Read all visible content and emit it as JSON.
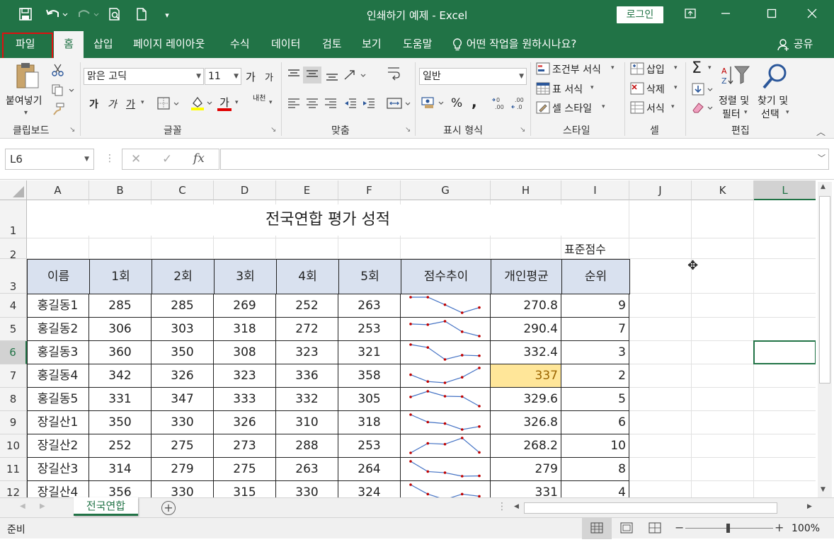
{
  "window": {
    "title": "인쇄하기 예제  -  Excel",
    "login_label": "로그인",
    "share_label": "공유"
  },
  "qat": {
    "save_icon": "save-icon",
    "undo_icon": "undo-icon",
    "redo_icon": "redo-icon",
    "preview_icon": "print-preview-icon",
    "new_icon": "new-document-icon"
  },
  "tabs": [
    "파일",
    "홈",
    "삽입",
    "페이지 레이아웃",
    "수식",
    "데이터",
    "검토",
    "보기",
    "도움말"
  ],
  "tell_me": "어떤 작업을 원하시나요?",
  "ribbon": {
    "clipboard": {
      "paste": "붙여넣기",
      "label": "클립보드"
    },
    "font": {
      "name": "맑은 고딕",
      "size": "11",
      "bold": "가",
      "italic": "가",
      "underline": "가",
      "grow": "가",
      "shrink": "가",
      "color_glyph": "가",
      "phonetic": "내천",
      "label": "글꼴"
    },
    "align": {
      "label": "맞춤"
    },
    "number": {
      "format": "일반",
      "percent": "%",
      "comma": ",",
      "label": "표시 형식"
    },
    "styles": {
      "conditional": "조건부 서식",
      "table": "표 서식",
      "cell": "셀 스타일",
      "label": "스타일"
    },
    "cells": {
      "insert": "삽입",
      "delete": "삭제",
      "format": "서식",
      "label": "셀"
    },
    "editing": {
      "sort_line1": "정렬 및",
      "sort_line2": "필터",
      "find_line1": "찾기 및",
      "find_line2": "선택",
      "label": "편집"
    }
  },
  "formula_bar": {
    "name_box": "L6",
    "fx": "fx",
    "value": ""
  },
  "columns": [
    "A",
    "B",
    "C",
    "D",
    "E",
    "F",
    "G",
    "H",
    "I",
    "J",
    "K",
    "L"
  ],
  "rows": [
    "1",
    "2",
    "3",
    "4",
    "5",
    "6",
    "7",
    "8",
    "9",
    "10",
    "11",
    "12"
  ],
  "sheet": {
    "title": "전국연합 평가 성적",
    "subtitle": "표준점수",
    "headers": [
      "이름",
      "1회",
      "2회",
      "3회",
      "4회",
      "5회",
      "점수추이",
      "개인평균",
      "순위"
    ],
    "records": [
      {
        "name": "홍길동1",
        "scores": [
          "285",
          "285",
          "269",
          "252",
          "263"
        ],
        "avg": "270.8",
        "rank": "9"
      },
      {
        "name": "홍길동2",
        "scores": [
          "306",
          "303",
          "318",
          "272",
          "253"
        ],
        "avg": "290.4",
        "rank": "7"
      },
      {
        "name": "홍길동3",
        "scores": [
          "360",
          "350",
          "308",
          "323",
          "321"
        ],
        "avg": "332.4",
        "rank": "3"
      },
      {
        "name": "홍길동4",
        "scores": [
          "342",
          "326",
          "323",
          "336",
          "358"
        ],
        "avg": "337",
        "rank": "2"
      },
      {
        "name": "홍길동5",
        "scores": [
          "331",
          "347",
          "333",
          "332",
          "305"
        ],
        "avg": "329.6",
        "rank": "5"
      },
      {
        "name": "장길산1",
        "scores": [
          "350",
          "330",
          "326",
          "310",
          "318"
        ],
        "avg": "326.8",
        "rank": "6"
      },
      {
        "name": "장길산2",
        "scores": [
          "252",
          "275",
          "273",
          "288",
          "253"
        ],
        "avg": "268.2",
        "rank": "10"
      },
      {
        "name": "장길산3",
        "scores": [
          "314",
          "279",
          "275",
          "263",
          "264"
        ],
        "avg": "279",
        "rank": "8"
      },
      {
        "name": "장길산4",
        "scores": [
          "356",
          "330",
          "315",
          "330",
          "324"
        ],
        "avg": "331",
        "rank": "4"
      }
    ],
    "highlight_color": "#ffe699",
    "highlight_text_color": "#9c6500",
    "sparkline_color": "#4472c4",
    "marker_color": "#c00000"
  },
  "sheet_tab": "전국연합",
  "status": {
    "ready": "준비",
    "zoom": "100%"
  }
}
